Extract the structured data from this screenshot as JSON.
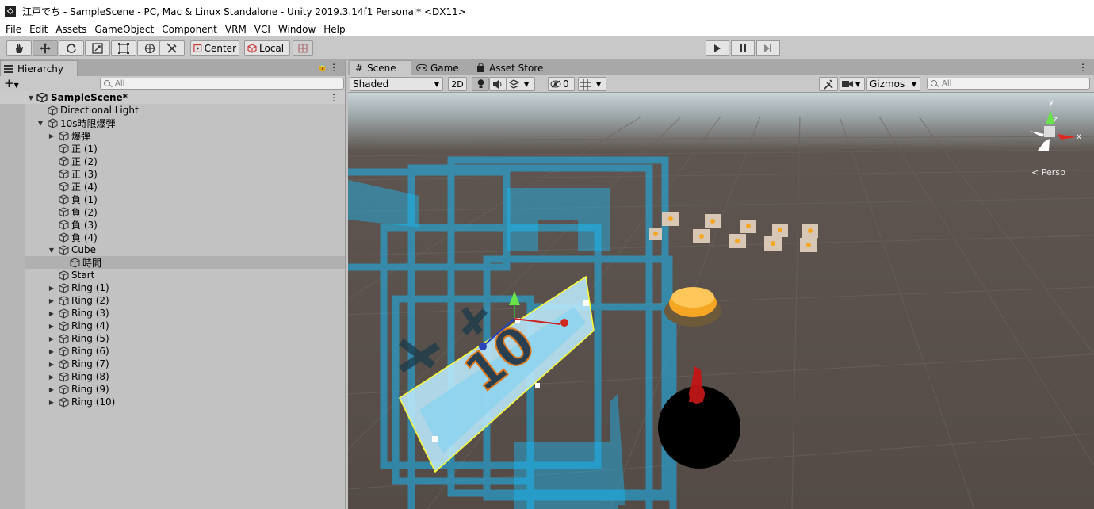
{
  "window": {
    "title": "江戸でち - SampleScene - PC, Mac & Linux Standalone - Unity 2019.3.14f1 Personal* <DX11>"
  },
  "menu": [
    "File",
    "Edit",
    "Assets",
    "GameObject",
    "Component",
    "VRM",
    "VCI",
    "Window",
    "Help"
  ],
  "toolbar": {
    "tools": [
      "hand-tool",
      "move-tool",
      "rotate-tool",
      "scale-tool",
      "rect-tool",
      "transform-tool",
      "custom-tool"
    ],
    "pivot_label": "Center",
    "space_label": "Local"
  },
  "hierarchy": {
    "tab_label": "Hierarchy",
    "search_placeholder": "All",
    "plus": "+",
    "scene": "SampleScene*",
    "items": [
      {
        "label": "Directional Light",
        "depth": 1,
        "arrow": ""
      },
      {
        "label": "10s時限爆弾",
        "depth": 1,
        "arrow": "down"
      },
      {
        "label": "爆弾",
        "depth": 2,
        "arrow": "right"
      },
      {
        "label": "正 (1)",
        "depth": 2,
        "arrow": ""
      },
      {
        "label": "正 (2)",
        "depth": 2,
        "arrow": ""
      },
      {
        "label": "正 (3)",
        "depth": 2,
        "arrow": ""
      },
      {
        "label": "正 (4)",
        "depth": 2,
        "arrow": ""
      },
      {
        "label": "負 (1)",
        "depth": 2,
        "arrow": ""
      },
      {
        "label": "負 (2)",
        "depth": 2,
        "arrow": ""
      },
      {
        "label": "負 (3)",
        "depth": 2,
        "arrow": ""
      },
      {
        "label": "負 (4)",
        "depth": 2,
        "arrow": ""
      },
      {
        "label": "Cube",
        "depth": 2,
        "arrow": "down"
      },
      {
        "label": "時間",
        "depth": 3,
        "arrow": "",
        "selected": true
      },
      {
        "label": "Start",
        "depth": 2,
        "arrow": ""
      },
      {
        "label": "Ring (1)",
        "depth": 2,
        "arrow": "right"
      },
      {
        "label": "Ring (2)",
        "depth": 2,
        "arrow": "right"
      },
      {
        "label": "Ring (3)",
        "depth": 2,
        "arrow": "right"
      },
      {
        "label": "Ring (4)",
        "depth": 2,
        "arrow": "right"
      },
      {
        "label": "Ring (5)",
        "depth": 2,
        "arrow": "right"
      },
      {
        "label": "Ring (6)",
        "depth": 2,
        "arrow": "right"
      },
      {
        "label": "Ring (7)",
        "depth": 2,
        "arrow": "right"
      },
      {
        "label": "Ring (8)",
        "depth": 2,
        "arrow": "right"
      },
      {
        "label": "Ring (9)",
        "depth": 2,
        "arrow": "right"
      },
      {
        "label": "Ring (10)",
        "depth": 2,
        "arrow": "right"
      }
    ]
  },
  "scene_view": {
    "tabs": {
      "scene": "Scene",
      "game": "Game",
      "asset_store": "Asset Store"
    },
    "shading": "Shaded",
    "mode_2d": "2D",
    "hidden_count": "0",
    "gizmos": "Gizmos",
    "search_placeholder": "All",
    "projection": "Persp",
    "axis_x": "x",
    "axis_y": "y",
    "axis_z": "z",
    "sign_text": "10"
  },
  "colors": {
    "ground": "#544b46",
    "sky": "#c9d4d9",
    "blue": "#19b7f3",
    "orange": "#f5a623",
    "selection_outline": "#ffff33"
  }
}
